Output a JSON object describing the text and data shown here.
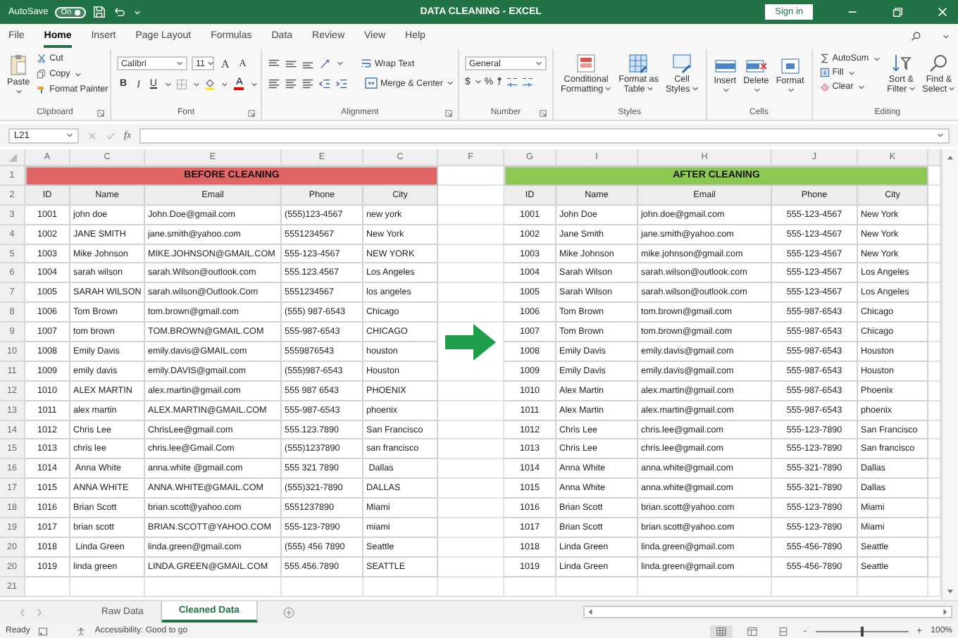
{
  "title_bar": {
    "autosave_label": "AutoSave",
    "autosave": {
      "label": "On",
      "on": true
    },
    "title": "DATA CLEANING - EXCEL",
    "sign_in": "Sign in"
  },
  "menu_tabs": [
    {
      "label": "File",
      "selected": false
    },
    {
      "label": "Home",
      "selected": true
    },
    {
      "label": "Insert",
      "selected": false
    },
    {
      "label": "Page Layout",
      "selected": false
    },
    {
      "label": "Formulas",
      "selected": false
    },
    {
      "label": "Data",
      "selected": false
    },
    {
      "label": "Review",
      "selected": false
    },
    {
      "label": "View",
      "selected": false
    },
    {
      "label": "Help",
      "selected": false
    }
  ],
  "ribbon": {
    "clipboard": {
      "paste": "Paste",
      "cut": "Cut",
      "copy": "Copy",
      "format_painter": "Format Painter",
      "label": "Clipboard"
    },
    "font": {
      "name": "Calibri",
      "size": "11",
      "grow": "A",
      "shrink": "A",
      "bold": "B",
      "italic": "I",
      "underline": "U",
      "font_color": "A",
      "label": "Font"
    },
    "alignment": {
      "wrap_text": "Wrap Text",
      "merge_center": "Merge & Center",
      "label": "Alignment"
    },
    "number": {
      "format": "General",
      "currency": "$",
      "percent": "%",
      "label": "Number"
    },
    "styles": {
      "buttons": [
        {
          "kind": "conditional",
          "lines": [
            "Conditional",
            "Formatting"
          ]
        },
        {
          "kind": "table",
          "lines": [
            "Format as",
            "Table"
          ]
        },
        {
          "kind": "cell",
          "lines": [
            "Cell",
            "Styles"
          ]
        }
      ],
      "label": "Styles"
    },
    "cells": {
      "buttons": [
        {
          "kind": "insert",
          "label": "Insert"
        },
        {
          "kind": "delete",
          "label": "Delete"
        },
        {
          "kind": "format",
          "label": "Format"
        }
      ],
      "label": "Cells"
    },
    "editing": {
      "autosum": "AutoSum",
      "fill": "Fill",
      "clear": "Clear",
      "sort_filter": [
        "Sort &",
        "Filter"
      ],
      "find_select": [
        "Find &",
        "Select"
      ],
      "label": "Editing"
    }
  },
  "formula_bar": {
    "name_box": "L21",
    "function_label": "fx"
  },
  "sheet": {
    "column_letters": [
      "A",
      "C",
      "E",
      "E",
      "C",
      "F",
      "G",
      "I",
      "H",
      "J",
      "K"
    ],
    "row_numbers": [
      "1",
      "2",
      "3",
      "4",
      "5",
      "6",
      "7",
      "8",
      "9",
      "10",
      "11",
      "12",
      "13",
      "14",
      "15",
      "16",
      "17",
      "18",
      "19",
      "20",
      "20",
      "21"
    ],
    "before": {
      "title": "BEFORE CLEANING",
      "headers": [
        "ID",
        "Name",
        "Email",
        "Phone",
        "City"
      ],
      "rows": [
        [
          "1001",
          "john doe",
          "John.Doe@gmail.com",
          "(555)123-4567",
          "new york"
        ],
        [
          "1002",
          "JANE SMITH",
          "jane.smith@yahoo.com",
          "5551234567",
          "New York"
        ],
        [
          "1003",
          "Mike Johnson",
          "MIKE.JOHNSON@GMAIL.COM",
          "555-123-4567",
          "NEW YORK"
        ],
        [
          "1004",
          "sarah wilson",
          "sarah.Wilson@outlook.com",
          "555.123.4567",
          "Los Angeles"
        ],
        [
          "1005",
          "SARAH WILSON",
          "sarah.wilson@Outlook.Com",
          "5551234567",
          "los angeles"
        ],
        [
          "1006",
          "Tom Brown",
          "tom.brown@gmail.com",
          "(555) 987-6543",
          "Chicago"
        ],
        [
          "1007",
          "tom brown",
          "TOM.BROWN@GMAIL.COM",
          "555-987-6543",
          "CHICAGO"
        ],
        [
          "1008",
          "Emily Davis",
          "emily.davis@GMAIL.com",
          "5559876543",
          "houston"
        ],
        [
          "1009",
          "emily davis",
          "emily.DAVIS@gmail.com",
          "(555)987-6543",
          "Houston"
        ],
        [
          "1010",
          "ALEX MARTIN",
          "alex.martin@gmail.com",
          "555 987 6543",
          "PHOENIX"
        ],
        [
          "1011",
          "alex martin",
          "ALEX.MARTIN@GMAIL.COM",
          "555-987-6543",
          "phoenix"
        ],
        [
          "1012",
          "Chris Lee",
          "ChrisLee@gmail.com",
          "555.123.7890",
          "San Francisco"
        ],
        [
          "1013",
          "chris lee",
          "chris.lee@Gmail.Com",
          "(555)1237890",
          "san francisco"
        ],
        [
          "1014",
          " Anna White",
          "anna.white @gmail.com",
          "555 321 7890",
          " Dallas"
        ],
        [
          "1015",
          "ANNA WHITE",
          "ANNA.WHITE@GMAIL.COM",
          "(555)321-7890",
          "DALLAS"
        ],
        [
          "1016",
          "Brian Scott",
          "brian.scott@yahoo.com",
          "5551237890",
          "Miami"
        ],
        [
          "1017",
          "brian scott",
          "BRIAN.SCOTT@YAHOO.COM",
          "555-123-7890",
          "miami"
        ],
        [
          "1018",
          " Linda Green",
          "linda.green@gmail.com",
          "(555) 456 7890",
          "Seattle"
        ],
        [
          "1019",
          "linda green",
          "LINDA.GREEN@GMAIL.COM",
          "555.456.7890",
          "SEATTLE"
        ]
      ]
    },
    "after": {
      "title": "AFTER CLEANING",
      "headers": [
        "ID",
        "Name",
        "Email",
        "Phone",
        "City"
      ],
      "rows": [
        [
          "1001",
          "John Doe",
          "john.doe@gmail.com",
          "555-123-4567",
          "New York"
        ],
        [
          "1002",
          "Jane Smith",
          "jane.smith@yahoo.com",
          "555-123-4567",
          "New York"
        ],
        [
          "1003",
          "Mike Johnson",
          "mike.johnson@gmail.com",
          "555-123-4567",
          "New York"
        ],
        [
          "1004",
          "Sarah Wilson",
          "sarah.wilson@outlook.com",
          "555-123-4567",
          "Los Angeles"
        ],
        [
          "1005",
          "Sarah Wilson",
          "sarah.wilson@outlook.com",
          "555-123-4567",
          "Los Angeles"
        ],
        [
          "1006",
          "Tom Brown",
          "tom.brown@gmail.com",
          "555-987-6543",
          "Chicago"
        ],
        [
          "1007",
          "Tom Brown",
          "tom.brown@gmail.com",
          "555-987-6543",
          "Chicago"
        ],
        [
          "1008",
          "Emily Davis",
          "emily.davis@gmail.com",
          "555-987-6543",
          "Houston"
        ],
        [
          "1009",
          "Emily Davis",
          "emily.davis@gmail.com",
          "555-987-6543",
          "Houston"
        ],
        [
          "1010",
          "Alex Martin",
          "alex.martin@gmail.com",
          "555-987-6543",
          "Phoenix"
        ],
        [
          "1011",
          "Alex Martin",
          "alex.martin@gmail.com",
          "555-987-6543",
          "phoenix"
        ],
        [
          "1012",
          "Chris Lee",
          "chris.lee@gmail.com",
          "555-123-7890",
          "San Francisco"
        ],
        [
          "1013",
          "Chris Lee",
          "chris.lee@gmail.com",
          "555-123-7890",
          "San francisco"
        ],
        [
          "1014",
          "Anna White",
          "anna.white@gmail.com",
          "555-321-7890",
          "Dallas"
        ],
        [
          "1015",
          "Anna White",
          "anna.white@gmail.com",
          "555-321-7890",
          "Dallas"
        ],
        [
          "1016",
          "Brian Scott",
          "brian.scott@yahoo.com",
          "555-123-7890",
          "Miami"
        ],
        [
          "1017",
          "Brian Scott",
          "brian.scott@yahoo.com",
          "555-123-7890",
          "Miami"
        ],
        [
          "1018",
          "Linda Green",
          "linda.green@gmail.com",
          "555-456-7890",
          "Seattle"
        ],
        [
          "1019",
          "Linda Green",
          "linda.green@gmail.com",
          "555-456-7890",
          "Seattle"
        ]
      ]
    }
  },
  "sheet_tabs": [
    {
      "label": "Raw Data",
      "selected": false
    },
    {
      "label": "Cleaned Data",
      "selected": true
    }
  ],
  "status_bar": {
    "ready": "Ready",
    "accessibility": "Accessibility: Good to go",
    "views": [
      {
        "kind": "normal",
        "selected": true
      },
      {
        "kind": "page_layout",
        "selected": false
      },
      {
        "kind": "page_break",
        "selected": false
      }
    ],
    "zoom_out": "-",
    "zoom_in": "+",
    "zoom": {
      "level": 0.5
    },
    "zoom_label": "100%"
  }
}
